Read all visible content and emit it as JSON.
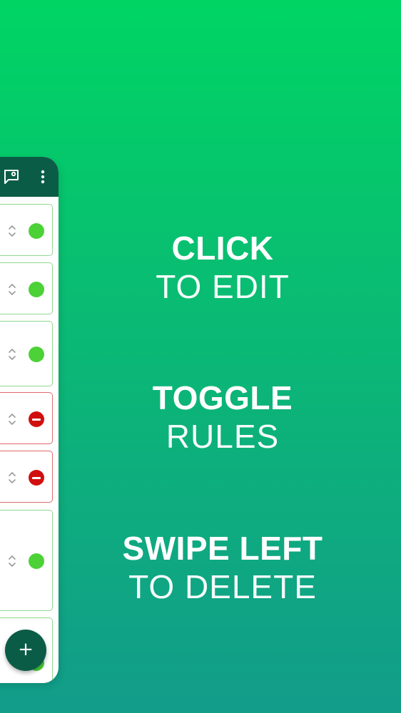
{
  "app": {
    "toolbar": {
      "icons": [
        "chat-settings-icon",
        "more-vert-icon"
      ]
    },
    "rules": [
      {
        "status": "enabled"
      },
      {
        "status": "enabled"
      },
      {
        "status": "enabled"
      },
      {
        "status": "disabled"
      },
      {
        "status": "disabled"
      },
      {
        "status": "enabled"
      },
      {
        "status": "enabled"
      }
    ],
    "fab": {
      "label": "+"
    }
  },
  "captions": [
    {
      "bold": "CLICK",
      "light": "TO EDIT"
    },
    {
      "bold": "TOGGLE",
      "light": "RULES"
    },
    {
      "bold": "SWIPE LEFT",
      "light": "TO DELETE"
    }
  ],
  "colors": {
    "background_top": "#00d563",
    "background_bottom": "#129c8a",
    "appbar": "#0b5c46",
    "enabled": "#4cd137",
    "disabled": "#d10f0f"
  }
}
